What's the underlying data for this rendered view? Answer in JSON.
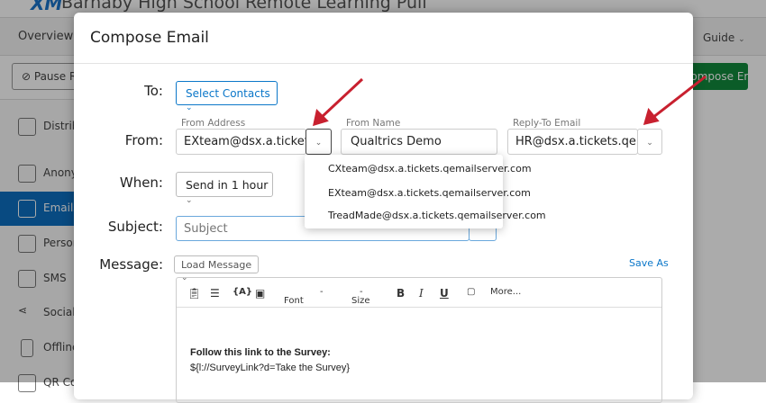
{
  "background": {
    "logo": "XM",
    "app_title": "Barnaby High School Remote Learning Pull",
    "nav": {
      "overview": "Overview",
      "guide": "Guide"
    },
    "toolbar": {
      "pause": "Pause R",
      "compose": "Compose Email"
    },
    "sidebar": [
      {
        "label": "Distributions",
        "icon": "list-icon"
      },
      {
        "label": "Anonymous Link",
        "icon": "link-icon"
      },
      {
        "label": "Emails",
        "icon": "envelope-icon",
        "selected": true
      },
      {
        "label": "Personal Links",
        "icon": "fingerprint-icon"
      },
      {
        "label": "SMS",
        "icon": "chat-icon"
      },
      {
        "label": "Social Media",
        "icon": "share-icon"
      },
      {
        "label": "Offline App",
        "icon": "tablet-icon"
      },
      {
        "label": "QR Code",
        "icon": "qr-icon"
      }
    ]
  },
  "modal": {
    "title": "Compose Email",
    "to": {
      "label": "To:",
      "button": "Select Contacts"
    },
    "from": {
      "label": "From:",
      "address_label": "From Address",
      "address_value": "EXteam@dsx.a.tickets.",
      "name_label": "From Name",
      "name_value": "Qualtrics Demo",
      "reply_label": "Reply-To Email",
      "reply_value": "HR@dsx.a.tickets.qemailserver.com"
    },
    "from_options": [
      "CXteam@dsx.a.tickets.qemailserver.com",
      "EXteam@dsx.a.tickets.qemailserver.com",
      "TreadMade@dsx.a.tickets.qemailserver.com"
    ],
    "when": {
      "label": "When:",
      "value": "Send in 1 hour"
    },
    "subject": {
      "label": "Subject:",
      "placeholder": "Subject"
    },
    "message": {
      "label": "Message:",
      "load": "Load Message",
      "save_as": "Save As",
      "toolbar": {
        "font": "Font",
        "size": "Size",
        "bold": "B",
        "italic": "I",
        "underline": "U",
        "more": "More..."
      },
      "body_heading": "Follow this link to the Survey:",
      "body_link": "${l://SurveyLink?d=Take the Survey}"
    }
  },
  "colors": {
    "accent": "#0b77c9",
    "green": "#118a3c",
    "selected": "#0d6fc0",
    "arrow": "#c8202f"
  }
}
